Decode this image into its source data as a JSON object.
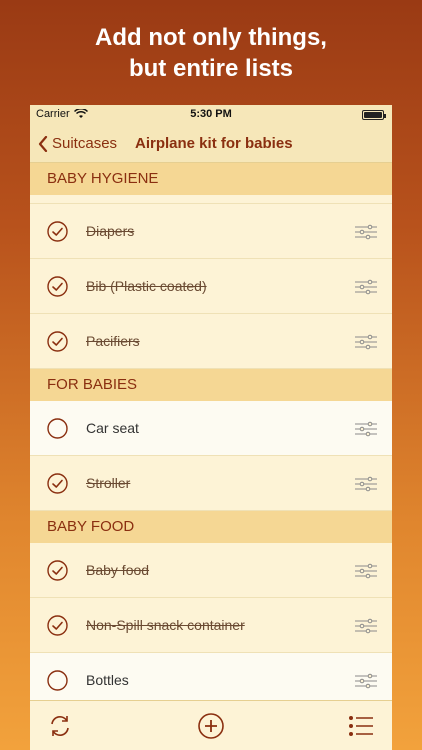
{
  "headline": {
    "line1": "Add not only things,",
    "line2": "but entire lists"
  },
  "status": {
    "carrier": "Carrier",
    "time": "5:30 PM"
  },
  "nav": {
    "back_label": "Suitcases",
    "title": "Airplane kit for babies"
  },
  "sections": [
    {
      "title": "BABY HYGIENE",
      "items": [
        {
          "label": "Diapers",
          "checked": true
        },
        {
          "label": "Bib (Plastic coated)",
          "checked": true
        },
        {
          "label": "Pacifiers",
          "checked": true
        }
      ]
    },
    {
      "title": "FOR BABIES",
      "items": [
        {
          "label": "Car seat",
          "checked": false
        },
        {
          "label": "Stroller",
          "checked": true
        }
      ]
    },
    {
      "title": "BABY FOOD",
      "items": [
        {
          "label": "Baby food",
          "checked": true
        },
        {
          "label": "Non-Spill snack container",
          "checked": true
        },
        {
          "label": "Bottles",
          "checked": false
        }
      ]
    }
  ],
  "colors": {
    "accent": "#8a2f10",
    "section_bg": "#f5d794",
    "row_bg": "#fdf3d6"
  },
  "toolbar": {
    "icons": [
      "sync-icon",
      "add-icon",
      "list-icon"
    ]
  }
}
